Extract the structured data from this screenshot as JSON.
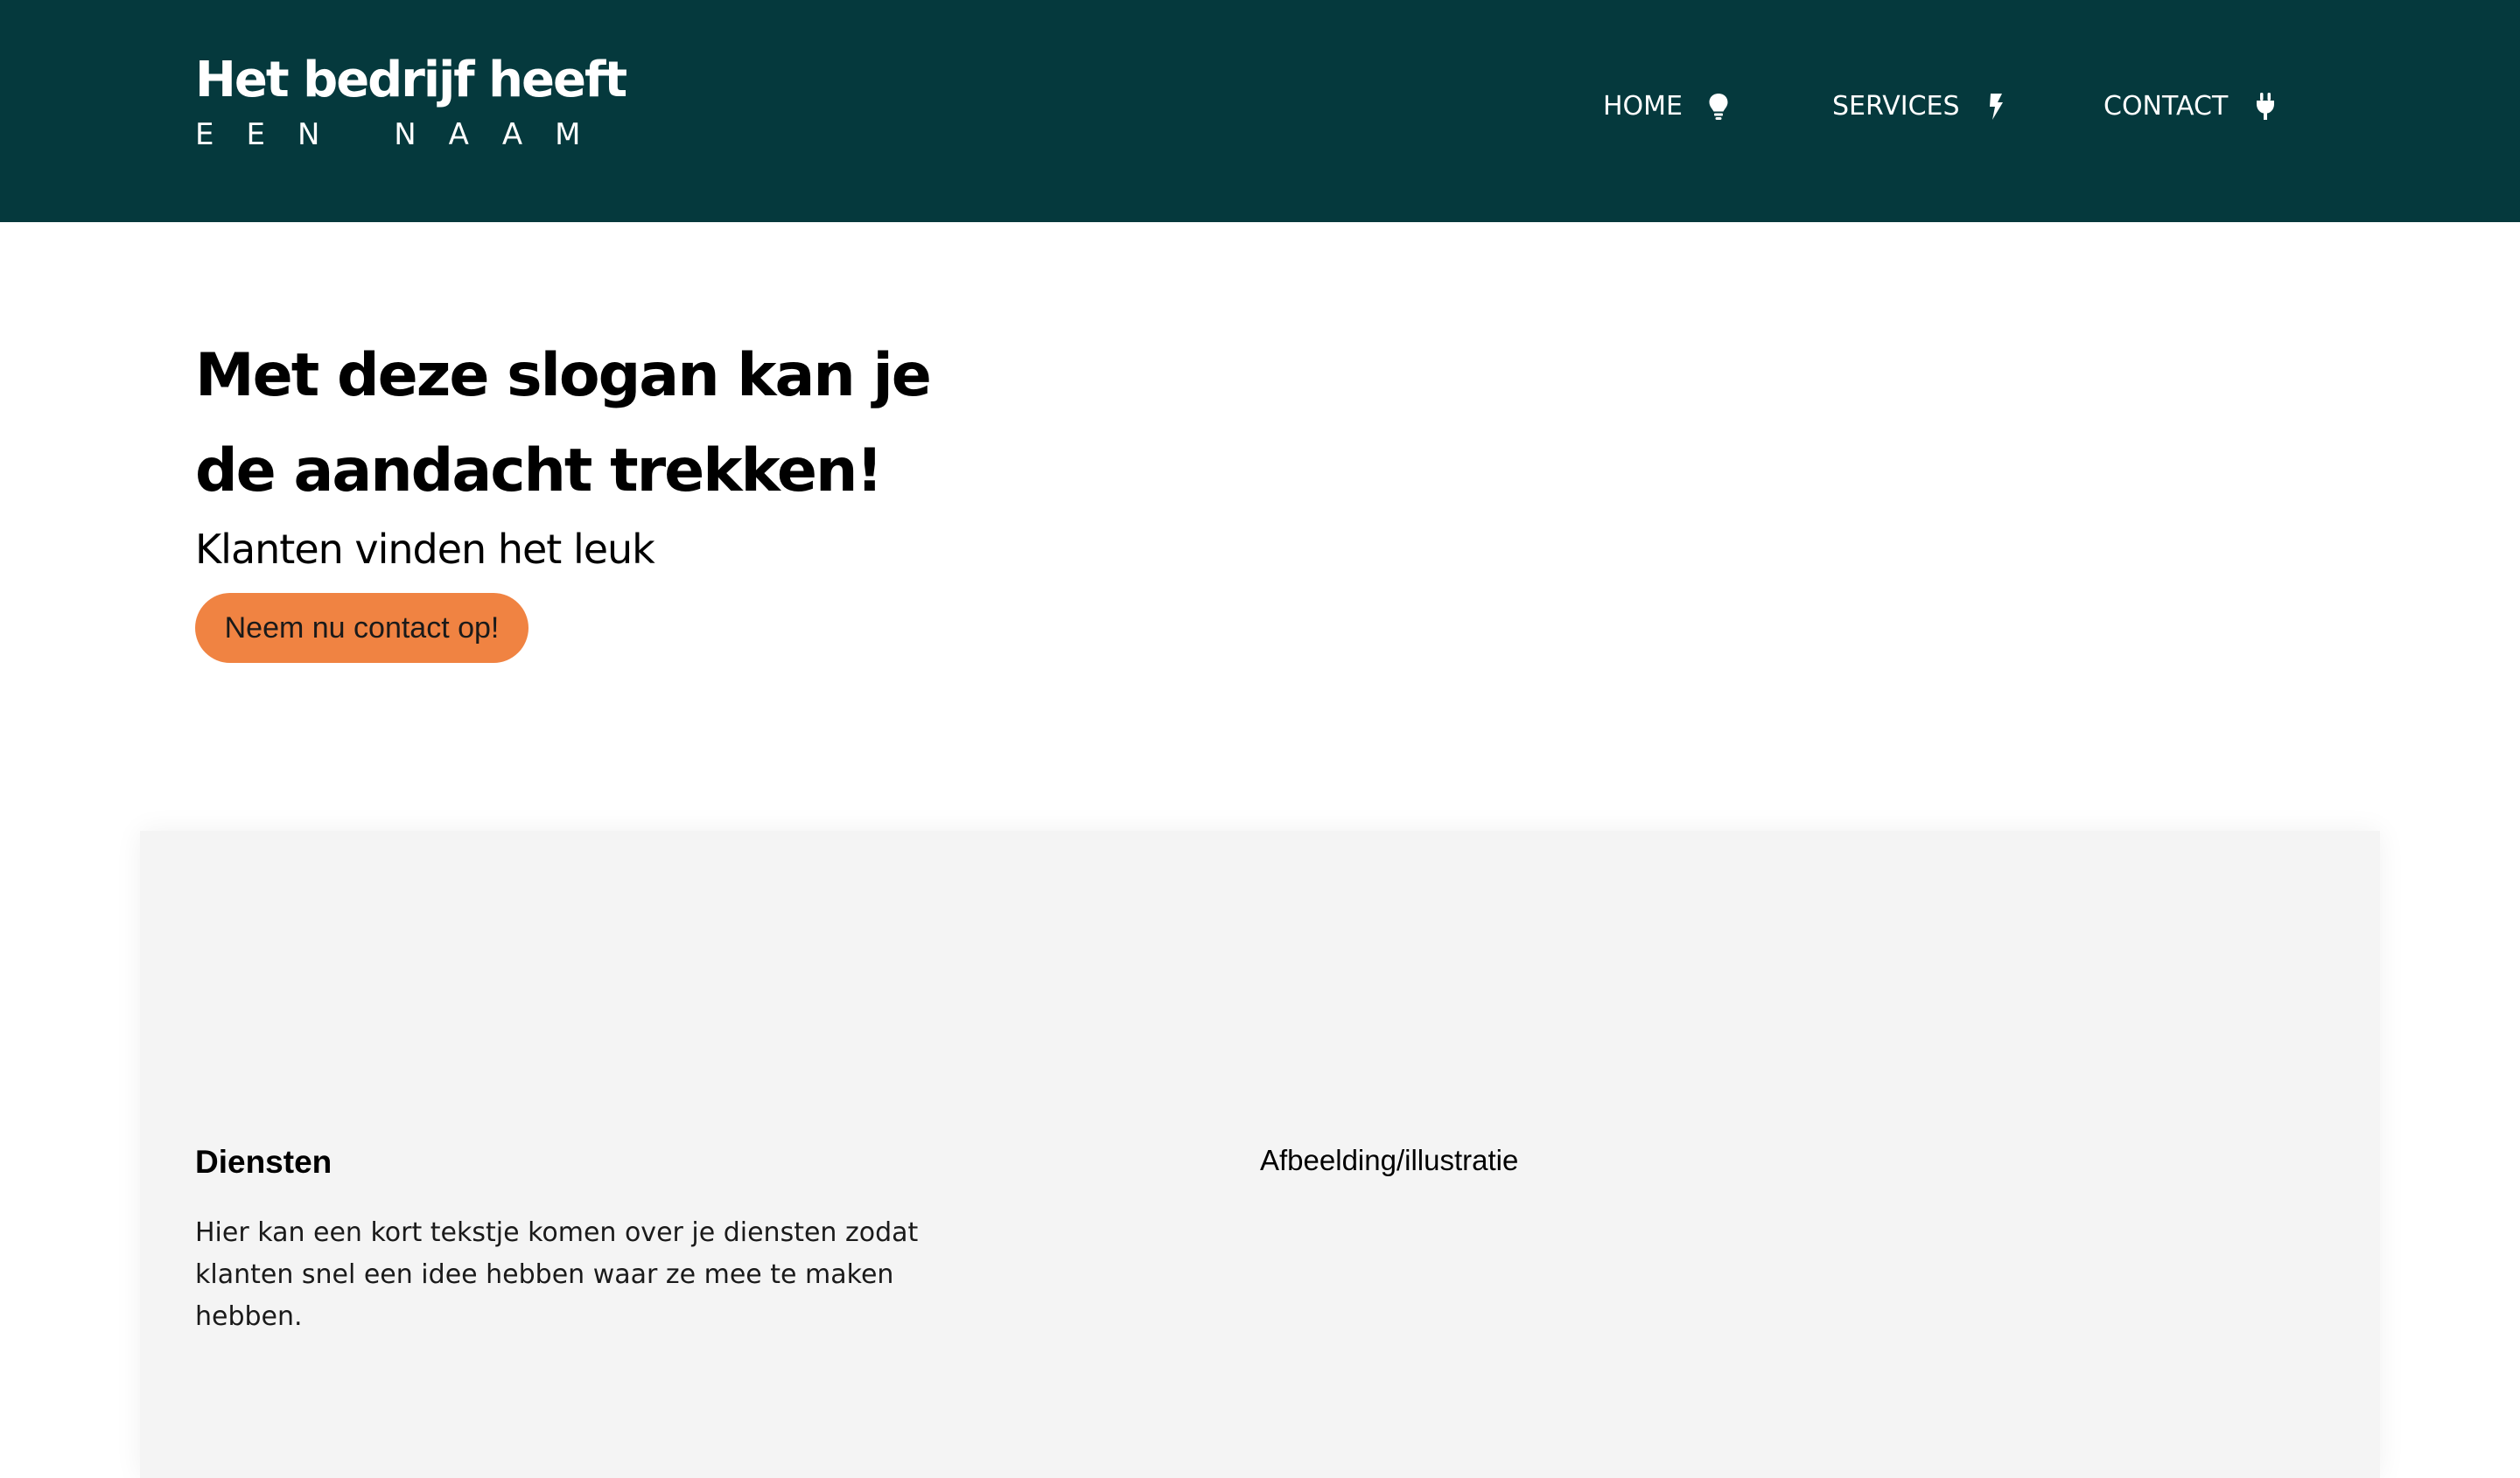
{
  "header": {
    "brand_title": "Het bedrijf heeft",
    "brand_subtitle": "EEN NAAM",
    "nav": [
      {
        "label": "HOME",
        "icon": "lightbulb-icon"
      },
      {
        "label": "SERVICES",
        "icon": "bolt-icon"
      },
      {
        "label": "CONTACT",
        "icon": "plug-icon"
      }
    ],
    "background_color": "#05393d"
  },
  "hero": {
    "title": "Met deze slogan kan je de aandacht trekken!",
    "subtitle": "Klanten vinden het leuk",
    "cta_label": "Neem nu contact op!",
    "cta_color": "#f08342"
  },
  "services": {
    "heading": "Diensten",
    "text": "Hier kan een kort tekstje komen over je diensten zodat klanten snel een idee hebben waar ze mee te maken hebben.",
    "illustration_label": "Afbeelding/illustratie",
    "panel_color": "#f4f4f4"
  }
}
